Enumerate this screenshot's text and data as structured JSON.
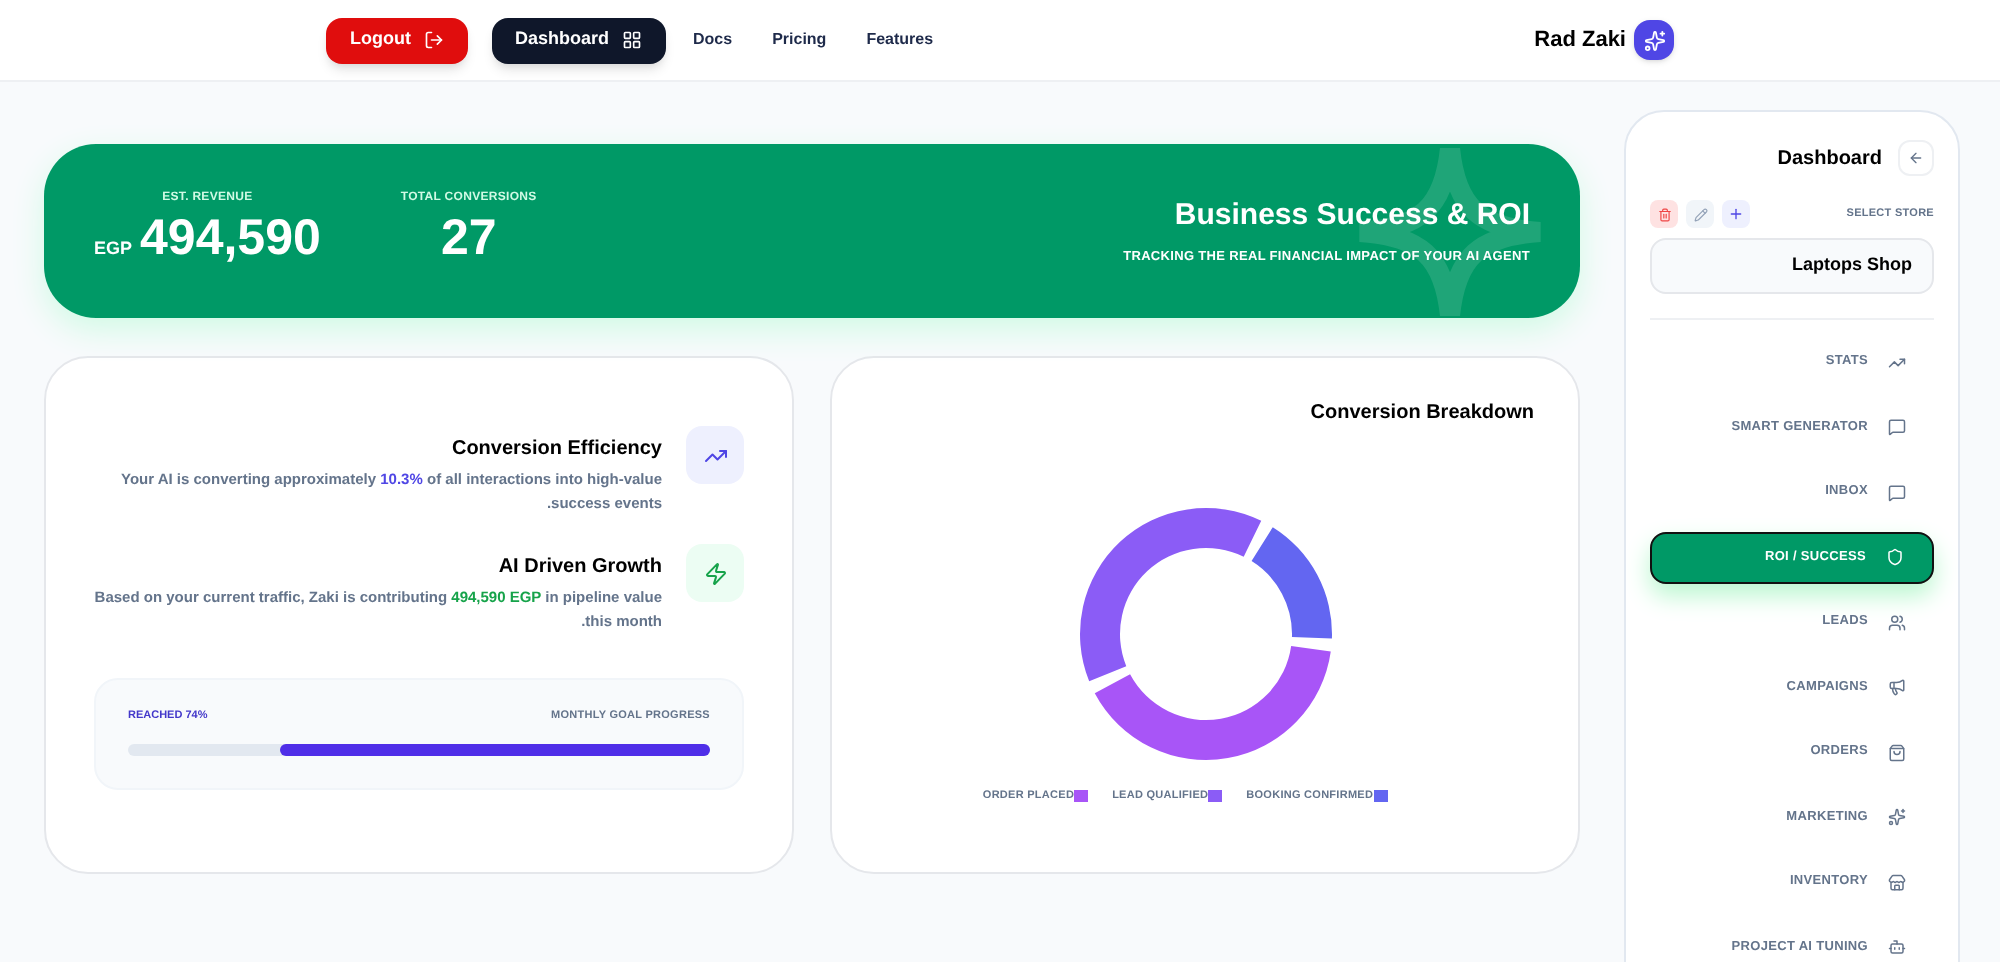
{
  "header": {
    "nav_buttons": [
      {
        "label": "Logout",
        "kind": "logout"
      },
      {
        "label": "Dashboard",
        "kind": "dashboard"
      }
    ],
    "links": [
      "Docs",
      "Pricing",
      "Features"
    ],
    "user": {
      "name": "Rad Zaki"
    }
  },
  "banner": {
    "stats": [
      {
        "label": "EST. REVENUE",
        "prefix": "EGP",
        "value": "494,590"
      },
      {
        "label": "TOTAL CONVERSIONS",
        "value": "27"
      }
    ],
    "title": "Business Success & ROI",
    "subtitle": "TRACKING THE REAL FINANCIAL IMPACT OF YOUR AI AGENT"
  },
  "insights": [
    {
      "title": "Conversion Efficiency",
      "kind": "trend",
      "color": "#4f46e5",
      "segments": [
        {
          "text": "Your AI is converting approximately ",
          "kind": "plain"
        },
        {
          "text": "10.3%",
          "kind": "metric"
        },
        {
          "text": " of all interactions into high-value success events.",
          "kind": "plain"
        }
      ]
    },
    {
      "title": "AI Driven Growth",
      "kind": "bolt",
      "color": "#16a34a",
      "segments": [
        {
          "text": "Based on your current traffic, Zaki is contributing ",
          "kind": "plain"
        },
        {
          "text": "494,590 EGP",
          "kind": "metric"
        },
        {
          "text": " in pipeline value this month.",
          "kind": "plain"
        }
      ]
    }
  ],
  "goal": {
    "reached": "REACHED 74%",
    "label": "MONTHLY GOAL PROGRESS",
    "level": 0.74
  },
  "breakdown": {
    "title": "Conversion Breakdown",
    "legend": [
      {
        "label": "ORDER PLACED",
        "color": "#a855f7"
      },
      {
        "label": "LEAD QUALIFIED",
        "color": "#8b5cf6"
      },
      {
        "label": "BOOKING CONFIRMED",
        "color": "#6366f1"
      }
    ]
  },
  "sidebar": {
    "title": "Dashboard",
    "store_label": "SELECT STORE",
    "store": "Laptops Shop",
    "items": [
      {
        "label": "STATS",
        "selected": false
      },
      {
        "label": "SMART GENERATOR",
        "selected": false
      },
      {
        "label": "INBOX",
        "selected": false
      },
      {
        "label": "ROI / SUCCESS",
        "selected": true
      },
      {
        "label": "LEADS",
        "selected": false
      },
      {
        "label": "CAMPAIGNS",
        "selected": false
      },
      {
        "label": "ORDERS",
        "selected": false
      },
      {
        "label": "MARKETING",
        "selected": false
      },
      {
        "label": "INVENTORY",
        "selected": false
      },
      {
        "label": "PROJECT AI TUNING",
        "selected": false
      }
    ]
  }
}
